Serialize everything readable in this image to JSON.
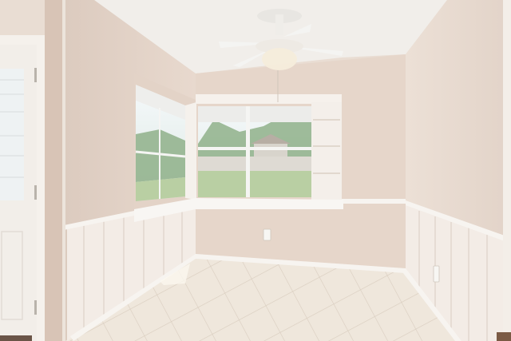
{
  "scene": {
    "subject": "empty-breakfast-nook",
    "palette": {
      "wall": "#e6d6ca",
      "wall_shadow": "#d8c4b6",
      "ceiling": "#f1eeea",
      "wainscot": "#f3ece6",
      "trim": "#f7f4f0",
      "floor": "#efe7dc",
      "grout": "#d9cdbf",
      "sky": "#e9f2f6",
      "foliage": "#8fb08a",
      "lawn": "#b9cfa3",
      "door": "#f2eee9",
      "fan": "#f5f5f3"
    }
  }
}
